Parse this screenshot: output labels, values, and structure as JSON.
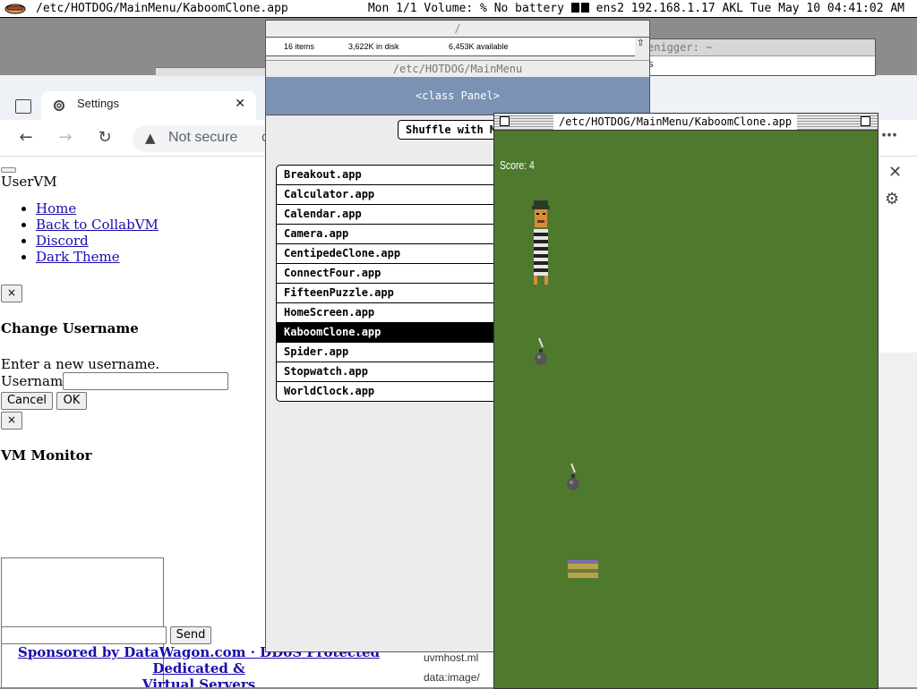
{
  "menubar": {
    "window_title": "/etc/HOTDOG/MainMenu/KaboomClone.app",
    "status": "Mon 1/1 Volume: % No battery",
    "network": "ens2 192.168.1.17 AKL Tue May 10 04:41:02 AM"
  },
  "terminal": {
    "title": "enigger: ~",
    "text": "ss"
  },
  "browser": {
    "tab_label": "Settings",
    "security_text": "Not secure",
    "url_fragment": "c"
  },
  "page": {
    "brand": "UserVM",
    "nav": [
      "Home",
      "Back to CollabVM",
      "Discord",
      "Dark Theme"
    ],
    "close_symbol": "×",
    "change_username": {
      "heading": "Change Username",
      "prompt": "Enter a new username.",
      "field_label": "Username",
      "cancel": "Cancel",
      "ok": "OK"
    },
    "monitor": {
      "heading": "VM Monitor",
      "send": "Send"
    },
    "sponsor_line1": "Sponsored by DataWagon.com · DDoS Protected Dedicated &",
    "sponsor_line2": "Virtual Servers"
  },
  "downloads": [
    "uvmhost.ml",
    "data:image/"
  ],
  "mainmenu": {
    "top_path": "/",
    "items_count": "16 items",
    "in_disk": "3,622K in disk",
    "available": "6,453K available",
    "path": "/etc/HOTDOG/MainMenu",
    "panel": "<class Panel>",
    "shuffle_button": "Shuffle with M",
    "apps": [
      "Breakout.app",
      "Calculator.app",
      "Calendar.app",
      "Camera.app",
      "CentipedeClone.app",
      "ConnectFour.app",
      "FifteenPuzzle.app",
      "HomeScreen.app",
      "KaboomClone.app",
      "Spider.app",
      "Stopwatch.app",
      "WorldClock.app"
    ],
    "selected_app": "KaboomClone.app"
  },
  "kaboom": {
    "title": "/etc/HOTDOG/MainMenu/KaboomClone.app",
    "score_text": "Score: 4",
    "background_color": "#4f7a2e"
  }
}
